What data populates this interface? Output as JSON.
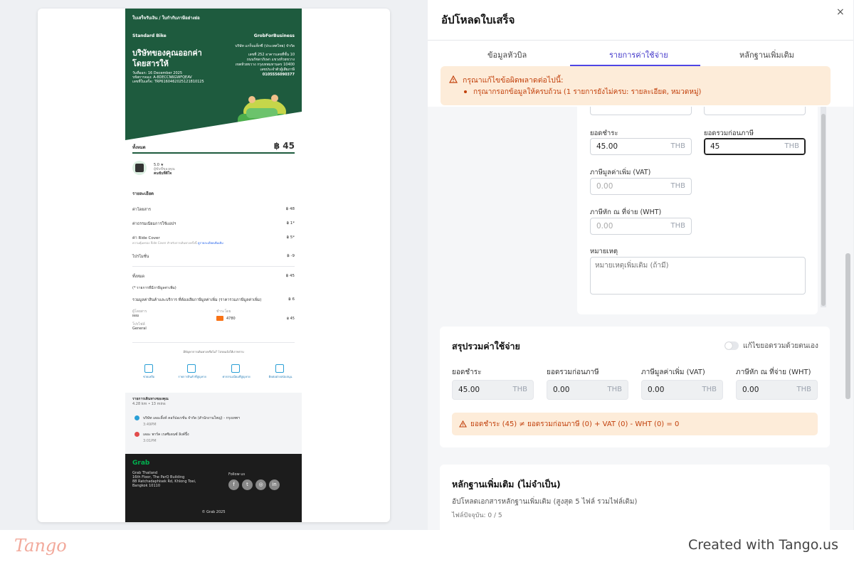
{
  "receipt": {
    "header_nav": "ใบเสร็จรับเงิน / ใบกำกับภาษีอย่างย่อ",
    "service": "Standard Bike",
    "brand": "GrobForBusiness",
    "title": "บริษัทของคุณออกค่าโดยสารให้",
    "company_lines": [
      "บริษัท แกร็บแท็กซี่ (ประเทศไทย) จำกัด",
      "เลขที่ 252 อาคารเลขที่ชั้น 10",
      "ถนนรัชดาภิเษก แขวงห้วยขวาง",
      "เขตห้วยขวาง กรุงเทพมหานคร 10400",
      "เลขประจำตัวผู้เสียภาษี",
      "0105556090377"
    ],
    "meta_lines": [
      "วันที่ออก: 16 December 2025",
      "รหัสการจอง: A-8DECCN6GWFQEAV",
      "เลขที่ใบเสร็จ: TRP6160462025121810125"
    ],
    "total_label": "ทั้งหมด",
    "total_value": "฿ 45",
    "rating": "5.0 ★",
    "driver_note": "ผู้ขับขี่ของคุณ",
    "driver_name": "คนขับที่ดีใจ",
    "detail_title": "รายละเอียด",
    "lines": [
      {
        "label": "ค่าโดยสาร",
        "value": "฿ 48"
      },
      {
        "label": "ค่าธรรมเนียมการใช้แอปฯ",
        "value": "฿ 1*"
      },
      {
        "label": "ค่า Ride Cover",
        "value": "฿ 5*"
      },
      {
        "label": "ไปรโมชั่น",
        "value": "฿ -9"
      },
      {
        "label": "ทั้งหมด",
        "value": "฿ 45"
      }
    ],
    "ride_cover_note": "ความคุ้มครอง Ride Cover สำหรับการเดินทางครั้งนี้",
    "ride_cover_link": "ดูรายละเอียดเพิ่มเติม",
    "vat_note": "(* รายการที่มีภาษีมูลค่าเพิ่ม)",
    "vat_line": {
      "label": "รวมมูลค่าสินค้าและบริการ ที่ต้องเสียภาษีมูลค่าเพิ่ม (ราคารวมภาษีมูลค่าเพิ่ม)",
      "value": "฿ 6"
    },
    "paid_by_label": "ผู้โดยสาร",
    "paid_by_value": "ผอม",
    "method_label": "ชำระโดย",
    "card_digits": "4780",
    "card_value": "฿ 45",
    "profile_label": "โปรไฟล์",
    "profile_value": "General",
    "question": "มีปัญหาการเดินทางหรือไม่? โปรดแจ้งให้เราทราบ",
    "actions": [
      "ช่วยเหลือ",
      "รายการสินค้าที่สูญหาย",
      "ค่าธรรมเนียมที่สูญหาย",
      "ติดต่อฝ่ายสนับสนุน"
    ],
    "trip_title": "รายการเดินทางของคุณ",
    "trip_meta": "4.28 km • 13 mins",
    "pickup": "บริษัท เดอะลิ้งค์ คอร์ปอเรชั่น จำกัด (สำนักงานใหญ่) - กรุงเทพฯ",
    "pickup_time": "3:49PM",
    "dropoff": "เดอะ พาร์ค เรสซิเดนซ์ ลิงค์ปิ้ง",
    "dropoff_time": "3:01PM",
    "footer_brand": "Grab",
    "footer_address": [
      "Grab Thailand",
      "16th Floor, The ParQ Building",
      "88 Ratchadaphisek Rd, Khlong Toei,",
      "Bangkok 10110"
    ],
    "follow_us": "Follow us",
    "copyright": "© Grab 2025"
  },
  "panel": {
    "title": "อัปโหลดใบเสร็จ",
    "close_glyph": "×",
    "tabs": [
      "ข้อมูลหัวบิล",
      "รายการค่าใช้จ่าย",
      "หลักฐานเพิ่มเติม"
    ],
    "active_tab": 1,
    "alert_title": "กรุณาแก้ไขข้อผิดพลาดต่อไปนี้:",
    "alert_item": "กรุณากรอกข้อมูลให้ครบถ้วน (1 รายการยังไม่ครบ: รายละเอียด, หมวดหมู่)",
    "form": {
      "amount_label": "ยอดชำระ",
      "amount_value": "45.00",
      "pretax_label": "ยอดรวมก่อนภาษี",
      "pretax_value": "45",
      "vat_label": "ภาษีมูลค่าเพิ่ม (VAT)",
      "vat_value": "0.00",
      "wht_label": "ภาษีหัก ณ ที่จ่าย (WHT)",
      "wht_value": "0.00",
      "note_label": "หมายเหตุ",
      "note_placeholder": "หมายเหตุเพิ่มเติม (ถ้ามี)",
      "unit": "THB"
    },
    "summary": {
      "title": "สรุปรวมค่าใช้จ่าย",
      "toggle_label": "แก้ไขยอดรวมด้วยตนเอง",
      "cols": [
        {
          "label": "ยอดชำระ",
          "value": "45.00"
        },
        {
          "label": "ยอดรวมก่อนภาษี",
          "value": "0.00"
        },
        {
          "label": "ภาษีมูลค่าเพิ่ม (VAT)",
          "value": "0.00"
        },
        {
          "label": "ภาษีหัก ณ ที่จ่าย (WHT)",
          "value": "0.00"
        }
      ],
      "warning": "ยอดชำระ (45) ≠ ยอดรวมก่อนภาษี (0) + VAT (0) - WHT (0) = 0"
    },
    "evidence": {
      "title": "หลักฐานเพิ่มเติม (ไม่จำเป็น)",
      "desc": "อัปโหลดเอกสารหลักฐานเพิ่มเติม (สูงสุด 5 ไฟล์ รวมไฟล์เดิม)",
      "count": "ไฟล์ปัจจุบัน: 0 / 5"
    }
  },
  "footer": {
    "brand": "Tango",
    "created": "Created with Tango.us"
  },
  "colors": {
    "grab_green": "#1e5b3e",
    "accent": "#4f46e5",
    "warning_bg": "#fdecd9",
    "warning_text": "#c2410c"
  }
}
